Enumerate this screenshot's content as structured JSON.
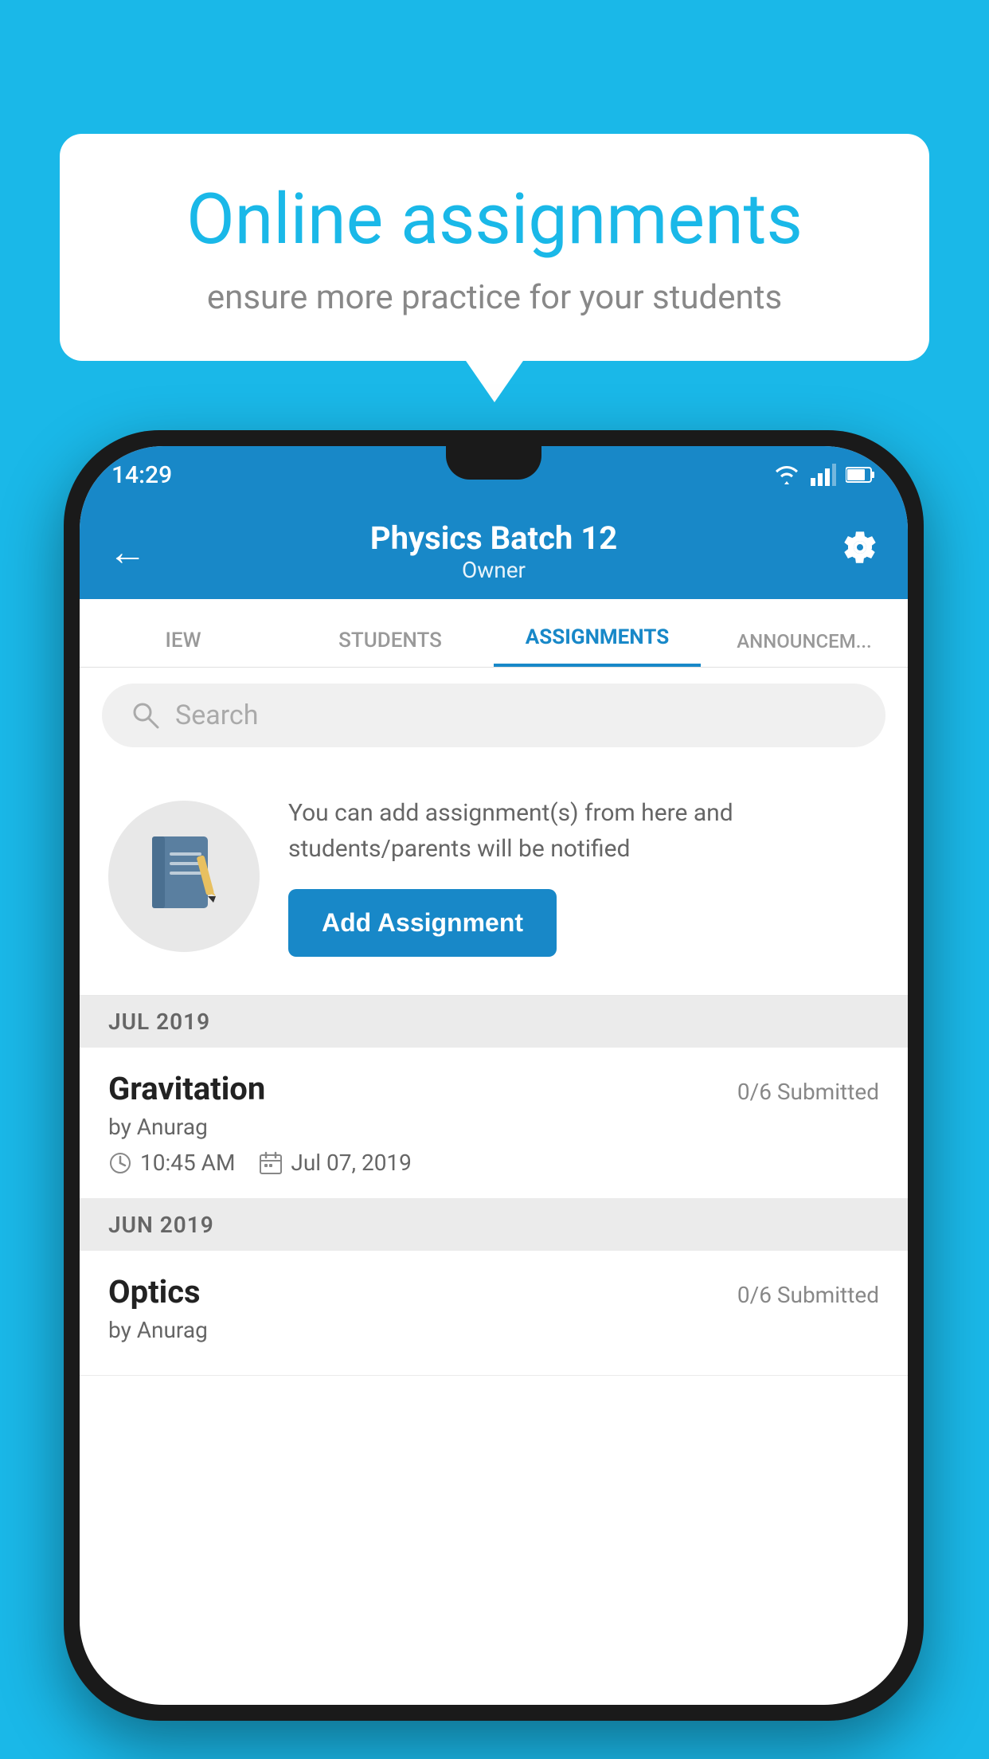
{
  "background_color": "#1ab8e8",
  "speech_bubble": {
    "title": "Online assignments",
    "subtitle": "ensure more practice for your students"
  },
  "status_bar": {
    "time": "14:29",
    "icons": [
      "wifi",
      "signal",
      "battery"
    ]
  },
  "app_header": {
    "title": "Physics Batch 12",
    "subtitle": "Owner",
    "back_label": "←",
    "settings_label": "⚙"
  },
  "tabs": [
    {
      "label": "IEW",
      "active": false
    },
    {
      "label": "STUDENTS",
      "active": false
    },
    {
      "label": "ASSIGNMENTS",
      "active": true
    },
    {
      "label": "ANNOUNCEM...",
      "active": false
    }
  ],
  "search": {
    "placeholder": "Search"
  },
  "promo_card": {
    "description": "You can add assignment(s) from here and students/parents will be notified",
    "button_label": "Add Assignment"
  },
  "sections": [
    {
      "label": "JUL 2019",
      "assignments": [
        {
          "name": "Gravitation",
          "submitted": "0/6 Submitted",
          "by": "by Anurag",
          "time": "10:45 AM",
          "date": "Jul 07, 2019"
        }
      ]
    },
    {
      "label": "JUN 2019",
      "assignments": [
        {
          "name": "Optics",
          "submitted": "0/6 Submitted",
          "by": "by Anurag",
          "time": "",
          "date": ""
        }
      ]
    }
  ]
}
